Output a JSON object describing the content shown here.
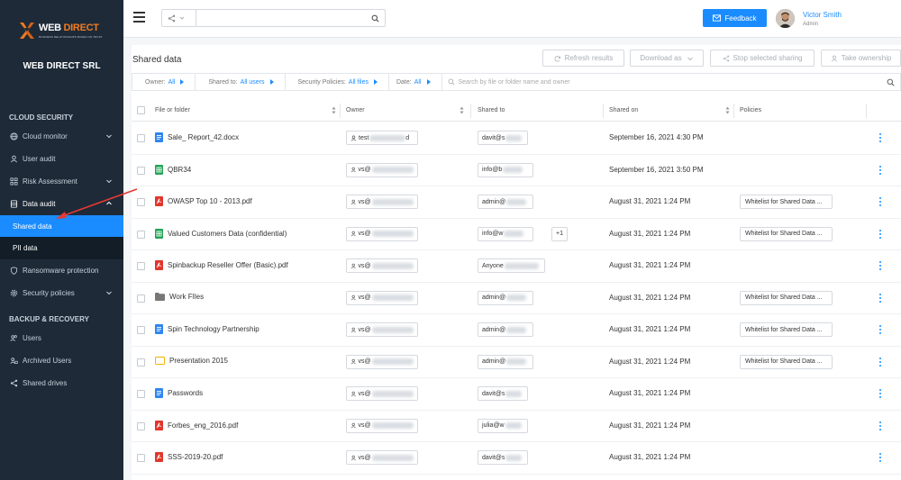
{
  "sidebar": {
    "logo_part1": "WEB",
    "logo_part2": "DIRECT",
    "logo_tagline": "BUSINESS RELATIONSHIPS BASED ON TRUST",
    "company": "WEB DIRECT SRL",
    "section_cloud": "CLOUD SECURITY",
    "section_backup": "BACKUP & RECOVERY",
    "items": [
      {
        "label": "Cloud monitor",
        "icon": "globe-icon"
      },
      {
        "label": "User audit",
        "icon": "user-icon"
      },
      {
        "label": "Risk Assessment",
        "icon": "grid-icon"
      },
      {
        "label": "Data audit",
        "icon": "database-icon"
      },
      {
        "label": "Shared data",
        "icon": ""
      },
      {
        "label": "PII data",
        "icon": ""
      },
      {
        "label": "Ransomware protection",
        "icon": "shield-icon"
      },
      {
        "label": "Security policies",
        "icon": "gear-icon"
      },
      {
        "label": "Users",
        "icon": "users-icon"
      },
      {
        "label": "Archived Users",
        "icon": "archived-users-icon"
      },
      {
        "label": "Shared drives",
        "icon": "share-icon"
      }
    ]
  },
  "topbar": {
    "feedback": "Feedback",
    "user_name": "Victor Smith",
    "user_role": "Admin"
  },
  "page": {
    "title": "Shared data",
    "buttons": {
      "refresh": "Refresh results",
      "download": "Download as",
      "stop": "Stop selected sharing",
      "take": "Take ownership"
    }
  },
  "filters": {
    "owner_label": "Owner:",
    "owner_value": "All",
    "shared_label": "Shared to:",
    "shared_value": "All users",
    "policies_label": "Security Policies:",
    "policies_value": "All files",
    "date_label": "Date:",
    "date_value": "All",
    "search_placeholder": "Search by file or folder name and owner"
  },
  "table": {
    "headers": {
      "file": "File or folder",
      "owner": "Owner",
      "shared": "Shared to",
      "shared_on": "Shared on",
      "policies": "Policies"
    },
    "rows": [
      {
        "file": "Sale_ Report_42.docx",
        "type": "doc",
        "owner": "test",
        "owner_end": "d",
        "shared": "davit@s",
        "extra": "",
        "date": "September 16, 2021 4:30 PM",
        "policy": ""
      },
      {
        "file": "QBR34",
        "type": "sheet",
        "owner": "vs@",
        "owner_end": "",
        "shared": "info@b",
        "extra": "",
        "date": "September 16, 2021 3:50 PM",
        "policy": ""
      },
      {
        "file": "OWASP Top 10 - 2013.pdf",
        "type": "pdf",
        "owner": "vs@",
        "owner_end": "",
        "shared": "admin@",
        "extra": "",
        "date": "August 31, 2021 1:24 PM",
        "policy": "Whitelist for Shared Data ..."
      },
      {
        "file": "Valued Customers Data (confidential)",
        "type": "sheet",
        "owner": "vs@",
        "owner_end": "",
        "shared": "info@w",
        "extra": "+1",
        "date": "August 31, 2021 1:24 PM",
        "policy": "Whitelist for Shared Data ..."
      },
      {
        "file": "Spinbackup Reseller Offer (Basic).pdf",
        "type": "pdf",
        "owner": "vs@",
        "owner_end": "",
        "shared": "Anyone",
        "extra": "",
        "date": "August 31, 2021 1:24 PM",
        "policy": ""
      },
      {
        "file": "Work FIles",
        "type": "folder",
        "owner": "vs@",
        "owner_end": "",
        "shared": "admin@",
        "extra": "",
        "date": "August 31, 2021 1:24 PM",
        "policy": "Whitelist for Shared Data ..."
      },
      {
        "file": "Spin Technology Partnership",
        "type": "doc",
        "owner": "vs@",
        "owner_end": "",
        "shared": "admin@",
        "extra": "",
        "date": "August 31, 2021 1:24 PM",
        "policy": "Whitelist for Shared Data ..."
      },
      {
        "file": "Presentation 2015",
        "type": "slides",
        "owner": "vs@",
        "owner_end": "",
        "shared": "admin@",
        "extra": "",
        "date": "August 31, 2021 1:24 PM",
        "policy": "Whitelist for Shared Data ..."
      },
      {
        "file": "Passwords",
        "type": "doc",
        "owner": "vs@",
        "owner_end": "",
        "shared": "davit@s",
        "extra": "",
        "date": "August 31, 2021 1:24 PM",
        "policy": ""
      },
      {
        "file": "Forbes_eng_2016.pdf",
        "type": "pdf",
        "owner": "vs@",
        "owner_end": "",
        "shared": "julia@w",
        "extra": "",
        "date": "August 31, 2021 1:24 PM",
        "policy": ""
      },
      {
        "file": "SSS-2019-20.pdf",
        "type": "pdf",
        "owner": "vs@",
        "owner_end": "",
        "shared": "davit@s",
        "extra": "",
        "date": "August 31, 2021 1:24 PM",
        "policy": ""
      }
    ]
  },
  "colors": {
    "sidebar_bg": "#1e2a38",
    "accent": "#1a8cff",
    "brand_orange": "#ef7b22",
    "annotation_arrow": "#e53935"
  }
}
